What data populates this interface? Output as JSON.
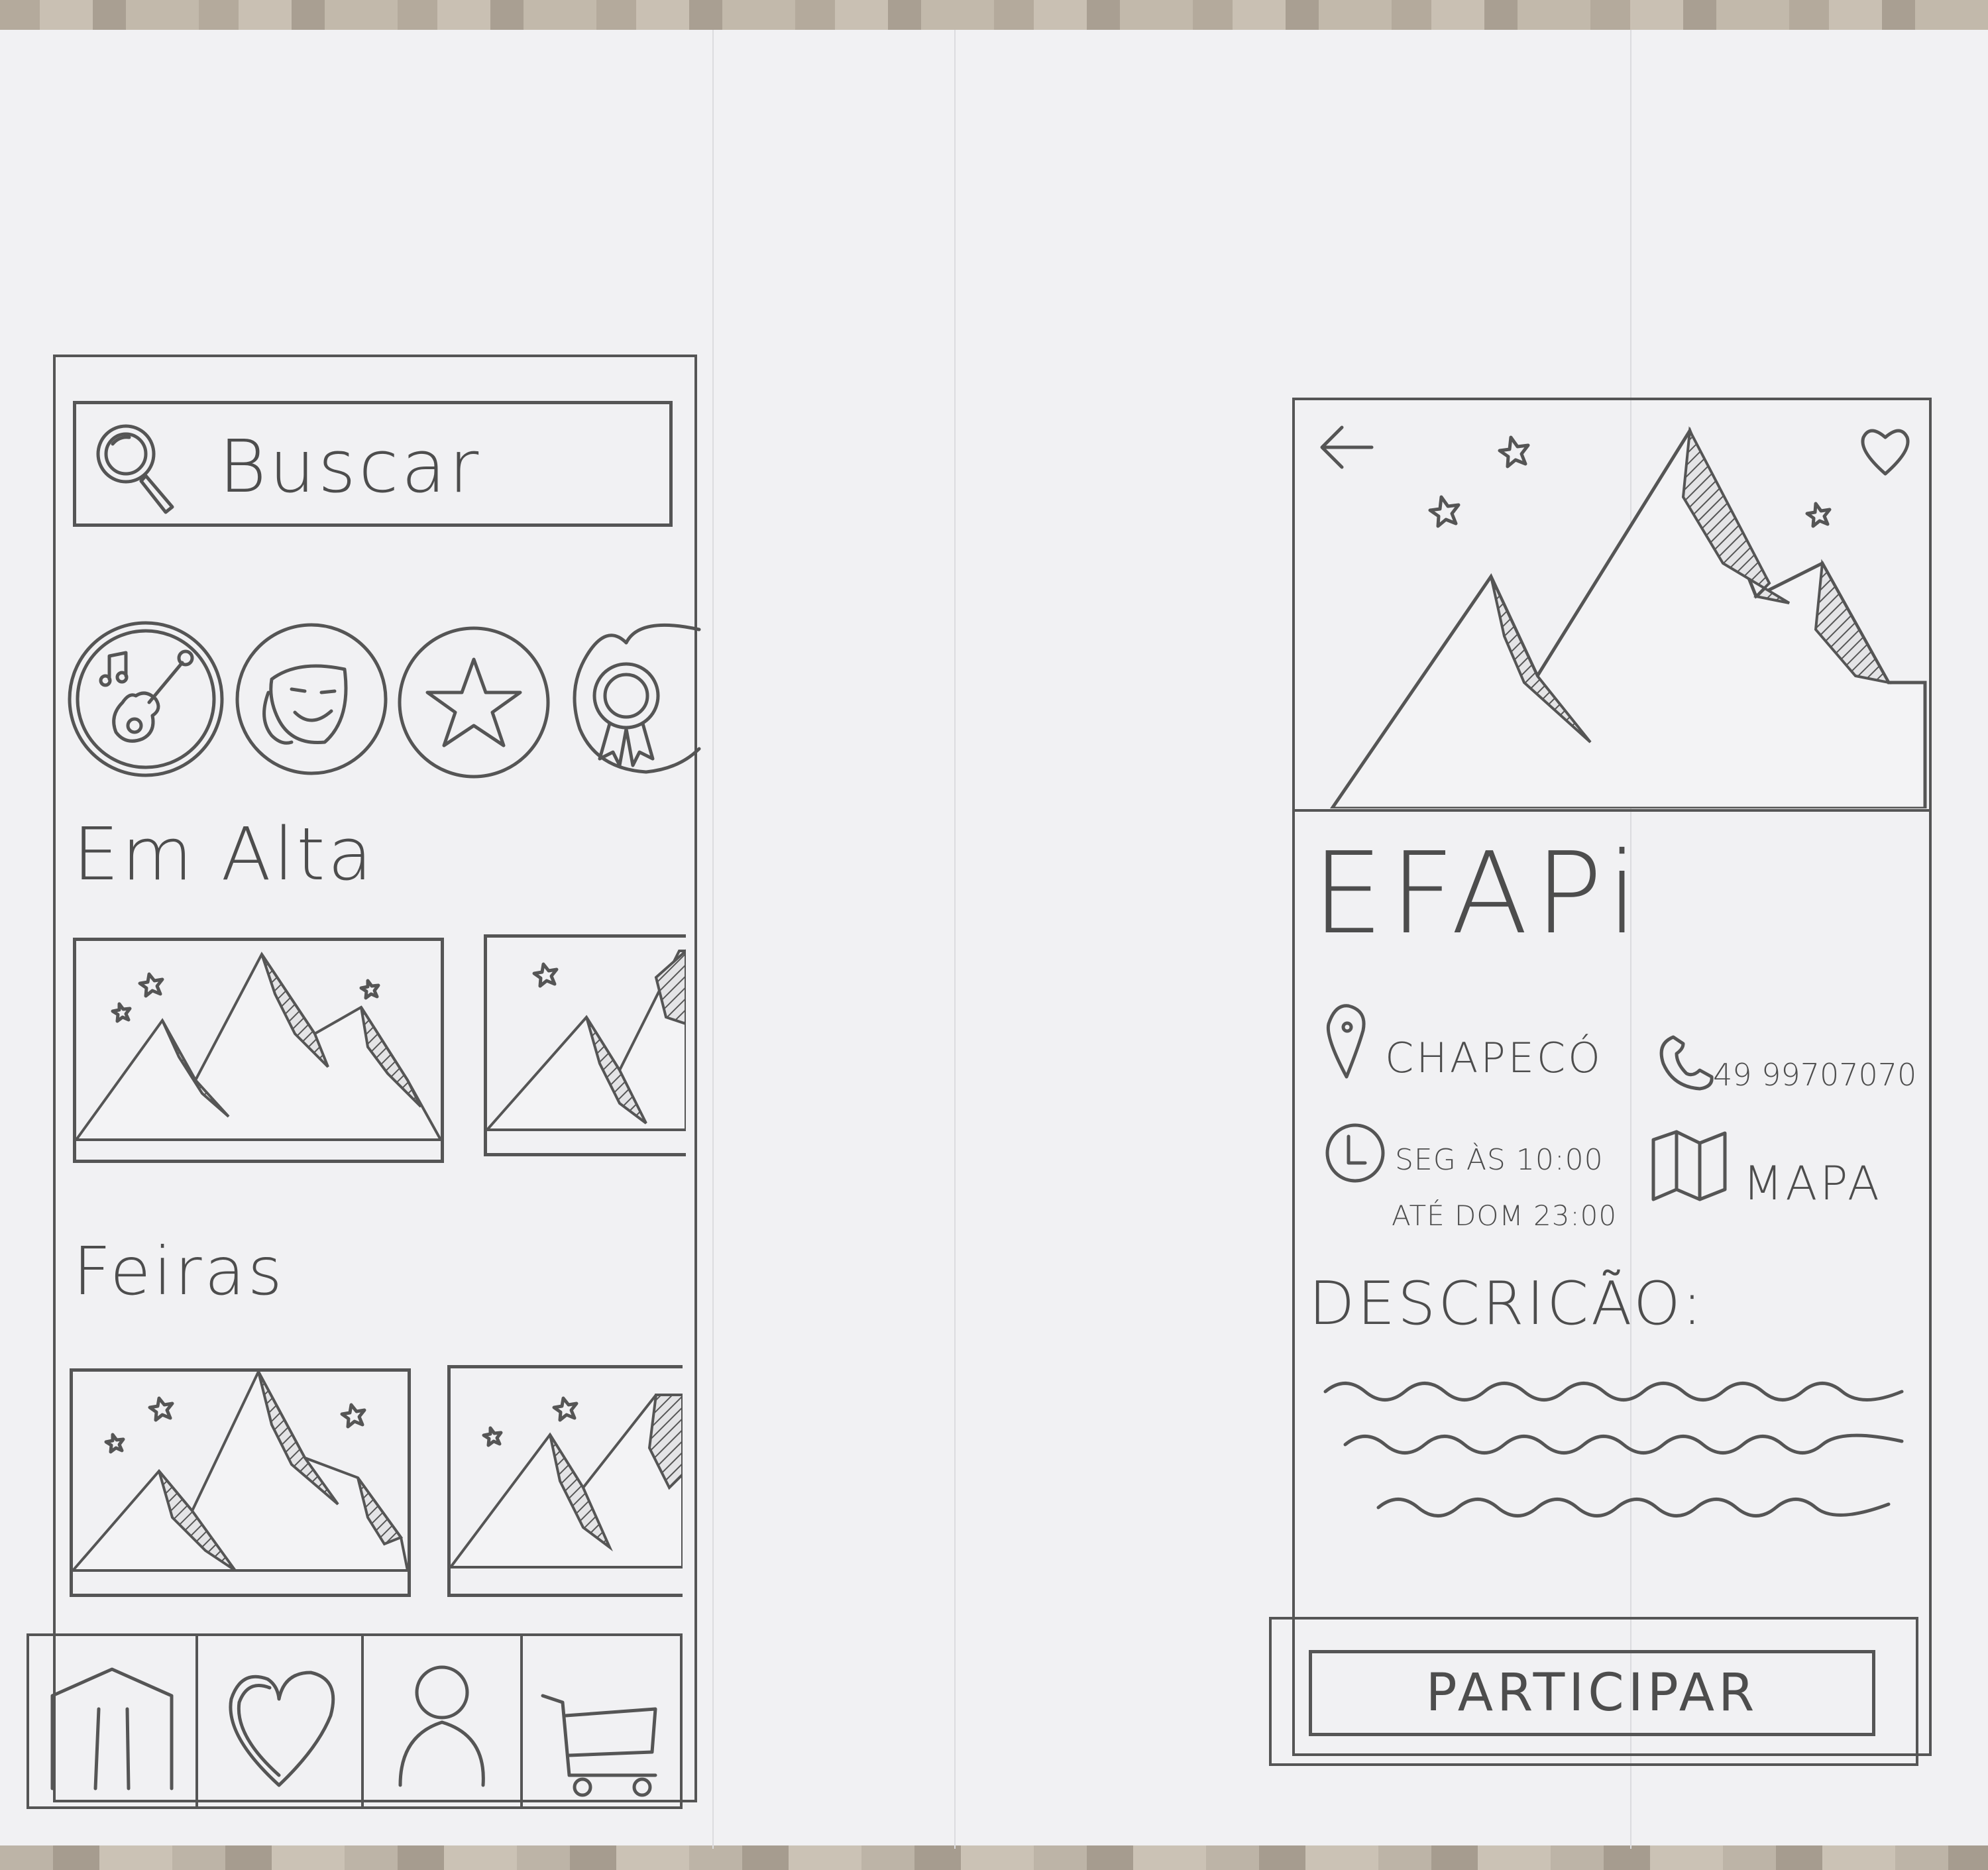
{
  "screen_home": {
    "search": {
      "placeholder": "Buscar",
      "icon": "search-icon"
    },
    "categories": [
      {
        "icon": "music-guitar-icon"
      },
      {
        "icon": "theater-mask-icon"
      },
      {
        "icon": "star-icon"
      },
      {
        "icon": "award-ribbon-icon"
      }
    ],
    "sections": [
      {
        "title": "Em Alta"
      },
      {
        "title": "Feiras"
      }
    ],
    "bottom_nav": [
      {
        "icon": "home-icon"
      },
      {
        "icon": "heart-icon"
      },
      {
        "icon": "profile-icon"
      },
      {
        "icon": "cart-icon"
      }
    ]
  },
  "screen_detail": {
    "back_icon": "back-arrow-icon",
    "favorite_icon": "heart-icon",
    "title": "EFAPi",
    "location": "CHAPECÓ",
    "phone": "49 99707070",
    "schedule_line1": "SEG ÀS 10:00",
    "schedule_line2": "ATÉ DOM 23:00",
    "map_label": "MAPA",
    "description_label": "DESCRICÃO:",
    "cta_label": "PARTICIPAR"
  }
}
